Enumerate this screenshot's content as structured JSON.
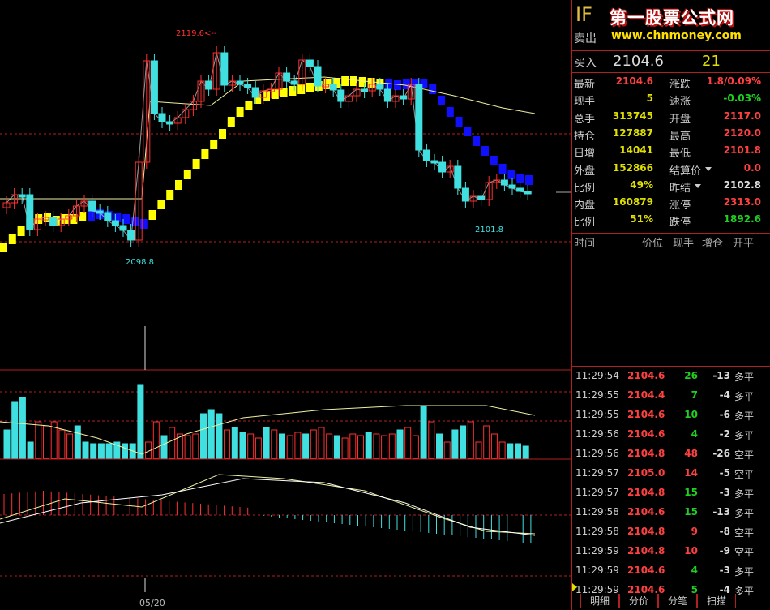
{
  "symbol": "IF",
  "sell_label": "卖出",
  "brand": {
    "name": "第一股票公式网",
    "url": "www.chnmoney.com"
  },
  "buy": {
    "label": "买入",
    "price": "2104.6",
    "volume": "21"
  },
  "quotes": [
    {
      "l1": "最新",
      "v1": "2104.6",
      "c1": "#ff4040",
      "l2": "涨跌",
      "v2": "1.8/0.09%",
      "c2": "#ff4040"
    },
    {
      "l1": "现手",
      "v1": "5",
      "c1": "#e0e000",
      "l2": "速涨",
      "v2": "-0.03%",
      "c2": "#20d020"
    },
    {
      "l1": "总手",
      "v1": "313745",
      "c1": "#e0e000",
      "l2": "开盘",
      "v2": "2117.0",
      "c2": "#ff4040"
    },
    {
      "l1": "持仓",
      "v1": "127887",
      "c1": "#e0e000",
      "l2": "最高",
      "v2": "2120.0",
      "c2": "#ff4040"
    },
    {
      "l1": "日增",
      "v1": "14041",
      "c1": "#e0e000",
      "l2": "最低",
      "v2": "2101.8",
      "c2": "#ff4040"
    },
    {
      "l1": "外盘",
      "v1": "152866",
      "c1": "#e0e000",
      "l2": "结算价",
      "v2": "0.0",
      "c2": "#ff4040",
      "dd": true
    },
    {
      "l1": "比例",
      "v1": "49%",
      "c1": "#e0e000",
      "l2": "昨结",
      "v2": "2102.8",
      "c2": "#dddddd",
      "dd": true
    },
    {
      "l1": "内盘",
      "v1": "160879",
      "c1": "#e0e000",
      "l2": "涨停",
      "v2": "2313.0",
      "c2": "#ff4040"
    },
    {
      "l1": "比例",
      "v1": "51%",
      "c1": "#e0e000",
      "l2": "跌停",
      "v2": "1892.6",
      "c2": "#20d020"
    }
  ],
  "ticks_header": {
    "time": "时间",
    "price": "价位",
    "vol": "现手",
    "oi": "增仓",
    "type": "开平"
  },
  "ticks": [
    {
      "time": "11:29:54",
      "price": "2104.6",
      "vol": "26",
      "oi": "-13",
      "type": "多平",
      "vc": "#20d020"
    },
    {
      "time": "11:29:55",
      "price": "2104.4",
      "vol": "7",
      "oi": "-4",
      "type": "多平",
      "vc": "#20d020"
    },
    {
      "time": "11:29:55",
      "price": "2104.6",
      "vol": "10",
      "oi": "-6",
      "type": "多平",
      "vc": "#20d020"
    },
    {
      "time": "11:29:56",
      "price": "2104.6",
      "vol": "4",
      "oi": "-2",
      "type": "多平",
      "vc": "#20d020"
    },
    {
      "time": "11:29:56",
      "price": "2104.8",
      "vol": "48",
      "oi": "-26",
      "type": "空平",
      "vc": "#ff4040"
    },
    {
      "time": "11:29:57",
      "price": "2105.0",
      "vol": "14",
      "oi": "-5",
      "type": "空平",
      "vc": "#ff4040"
    },
    {
      "time": "11:29:57",
      "price": "2104.8",
      "vol": "15",
      "oi": "-3",
      "type": "多平",
      "vc": "#20d020"
    },
    {
      "time": "11:29:58",
      "price": "2104.6",
      "vol": "15",
      "oi": "-13",
      "type": "多平",
      "vc": "#20d020"
    },
    {
      "time": "11:29:58",
      "price": "2104.8",
      "vol": "9",
      "oi": "-8",
      "type": "空平",
      "vc": "#ff4040"
    },
    {
      "time": "11:29:59",
      "price": "2104.8",
      "vol": "10",
      "oi": "-9",
      "type": "空平",
      "vc": "#ff4040"
    },
    {
      "time": "11:29:59",
      "price": "2104.6",
      "vol": "4",
      "oi": "-3",
      "type": "多平",
      "vc": "#20d020"
    },
    {
      "time": "11:29:59",
      "price": "2104.6",
      "vol": "5",
      "oi": "-4",
      "type": "多平",
      "vc": "#20d020"
    }
  ],
  "tabs": [
    "明细",
    "分价",
    "分笔",
    "扫描"
  ],
  "chart_data": {
    "type": "candlestick",
    "high_label": "2119.6<--",
    "low_label_1": "2098.8",
    "low_label_2": "2101.8",
    "date_label": "05/20",
    "colors": {
      "up": "#ff3030",
      "down": "#40e0e0",
      "band_up": "#ffff00",
      "band_down": "#1010ff",
      "ma": "#f0f0a0"
    }
  }
}
